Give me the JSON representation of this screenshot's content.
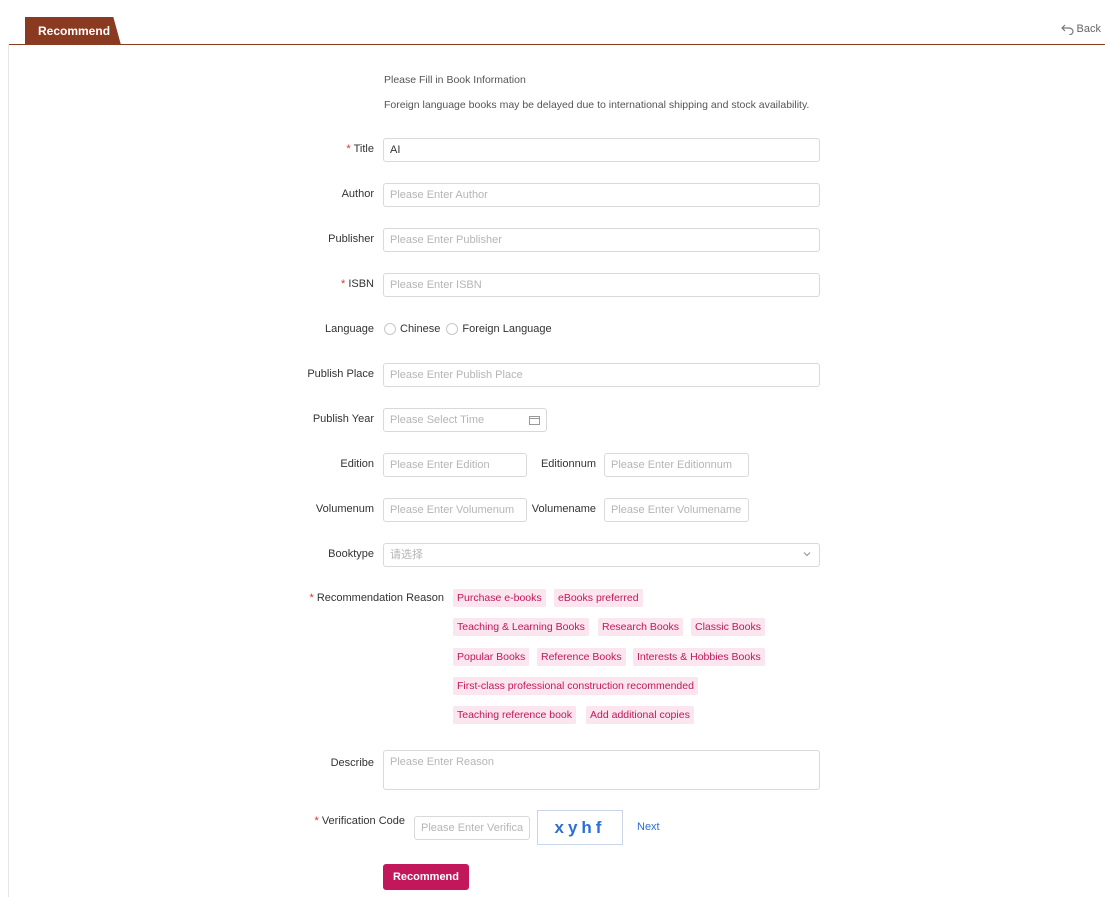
{
  "header": {
    "tab_label": "Recommend",
    "back_label": "Back"
  },
  "form": {
    "intro_title": "Please Fill in Book Information",
    "intro_note": "Foreign language books may be delayed due to international shipping and stock availability.",
    "title": {
      "label": "Title",
      "value": "AI",
      "required": "*"
    },
    "author": {
      "label": "Author",
      "placeholder": "Please Enter Author"
    },
    "publisher": {
      "label": "Publisher",
      "placeholder": "Please Enter Publisher"
    },
    "isbn": {
      "label": "ISBN",
      "placeholder": "Please Enter ISBN",
      "required": "*"
    },
    "language": {
      "label": "Language",
      "options": [
        "Chinese",
        "Foreign Language"
      ]
    },
    "publish_place": {
      "label": "Publish Place",
      "placeholder": "Please Enter Publish Place"
    },
    "publish_year": {
      "label": "Publish Year",
      "placeholder": "Please Select Time"
    },
    "edition": {
      "label": "Edition",
      "placeholder": "Please Enter Edition"
    },
    "editionnum": {
      "label": "Editionnum",
      "placeholder": "Please Enter Editionnum"
    },
    "volumenum": {
      "label": "Volumenum",
      "placeholder": "Please Enter Volumenum"
    },
    "volumename": {
      "label": "Volumename",
      "placeholder": "Please Enter Volumename"
    },
    "booktype": {
      "label": "Booktype",
      "placeholder": "请选择"
    },
    "reason": {
      "label": "Recommendation Reason",
      "required": "*",
      "tags": [
        "Purchase e-books",
        "eBooks preferred",
        "Teaching & Learning Books",
        "Research Books",
        "Classic Books",
        "Popular Books",
        "Reference Books",
        "Interests & Hobbies Books",
        "First-class professional construction recommended",
        "Teaching reference book",
        "Add additional copies"
      ]
    },
    "describe": {
      "label": "Describe",
      "placeholder": "Please Enter Reason"
    },
    "verification": {
      "label": "Verification Code",
      "required": "*",
      "placeholder": "Please Enter Verification Code",
      "captcha_text": "xyhf",
      "next_label": "Next"
    },
    "submit_label": "Recommend"
  }
}
